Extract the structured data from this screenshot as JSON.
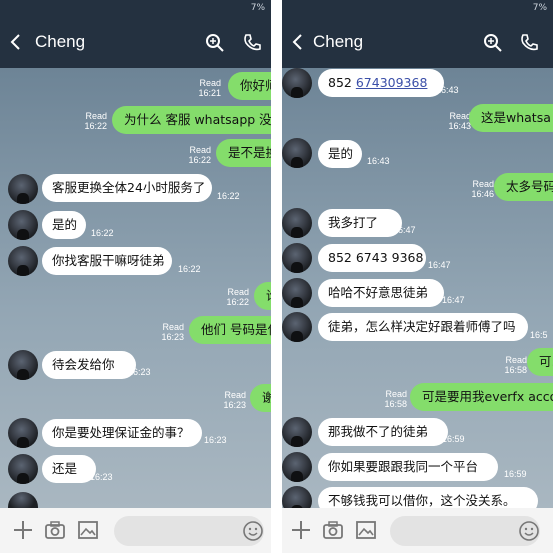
{
  "left": {
    "status": "7%",
    "contact": "Cheng",
    "messages": [
      {
        "dir": "out",
        "text": "你好师",
        "read": "Read",
        "time": "16:21"
      },
      {
        "dir": "out",
        "text": "为什么 客服 whatsapp 没用",
        "read": "Read",
        "time": "16:22"
      },
      {
        "dir": "out",
        "text": "是不是换",
        "read": "Read",
        "time": "16:22"
      },
      {
        "dir": "in",
        "text": "客服更换全体24小时服务了",
        "time": "16:22"
      },
      {
        "dir": "in",
        "text": "是的",
        "time": "16:22"
      },
      {
        "dir": "in",
        "text": "你找客服干嘛呀徒弟",
        "time": "16:22"
      },
      {
        "dir": "out",
        "text": "谁",
        "read": "Read",
        "time": "16:22"
      },
      {
        "dir": "out",
        "text": "他们 号码是什",
        "read": "Read",
        "time": "16:23"
      },
      {
        "dir": "in",
        "text": "待会发给你",
        "time": "16:23"
      },
      {
        "dir": "out",
        "text": "谢",
        "read": "Read",
        "time": "16:23"
      },
      {
        "dir": "in",
        "text": "你是要处理保证金的事？",
        "time": "16:23"
      },
      {
        "dir": "in",
        "text": "还是",
        "time": "16:23"
      }
    ]
  },
  "right": {
    "status": "7%",
    "contact": "Cheng",
    "messages": [
      {
        "dir": "in",
        "prefix": "852 ",
        "link": "674309368",
        "time": "16:43"
      },
      {
        "dir": "out",
        "text": "这是whatsa",
        "read": "Read",
        "time": "16:43"
      },
      {
        "dir": "in",
        "text": "是的",
        "time": "16:43"
      },
      {
        "dir": "out",
        "text": "太多号码",
        "read": "Read",
        "time": "16:46"
      },
      {
        "dir": "in",
        "text": "我多打了",
        "time": "16:47"
      },
      {
        "dir": "in",
        "text": "852 6743 9368",
        "time": "16:47"
      },
      {
        "dir": "in",
        "text": "哈哈不好意思徒弟",
        "time": "16:47"
      },
      {
        "dir": "in",
        "text": "徒弟，怎么样决定好跟着师傅了吗",
        "time": "16:5"
      },
      {
        "dir": "out",
        "text": "可以",
        "read": "Read",
        "time": "16:58"
      },
      {
        "dir": "out",
        "text": "可是要用我everfx acco",
        "read": "Read",
        "time": "16:58"
      },
      {
        "dir": "in",
        "text": "那我做不了的徒弟",
        "time": "16:59"
      },
      {
        "dir": "in",
        "text": "你如果要跟跟我同一个平台",
        "time": "16:59"
      },
      {
        "dir": "in",
        "text": "不够钱我可以借你，这个没关系。",
        "time": ""
      }
    ]
  },
  "icons": {
    "back": "back-arrow-icon",
    "search": "search-icon",
    "call": "phone-icon",
    "add": "plus-icon",
    "camera": "camera-icon",
    "gallery": "image-icon",
    "emoji": "emoji-icon"
  }
}
